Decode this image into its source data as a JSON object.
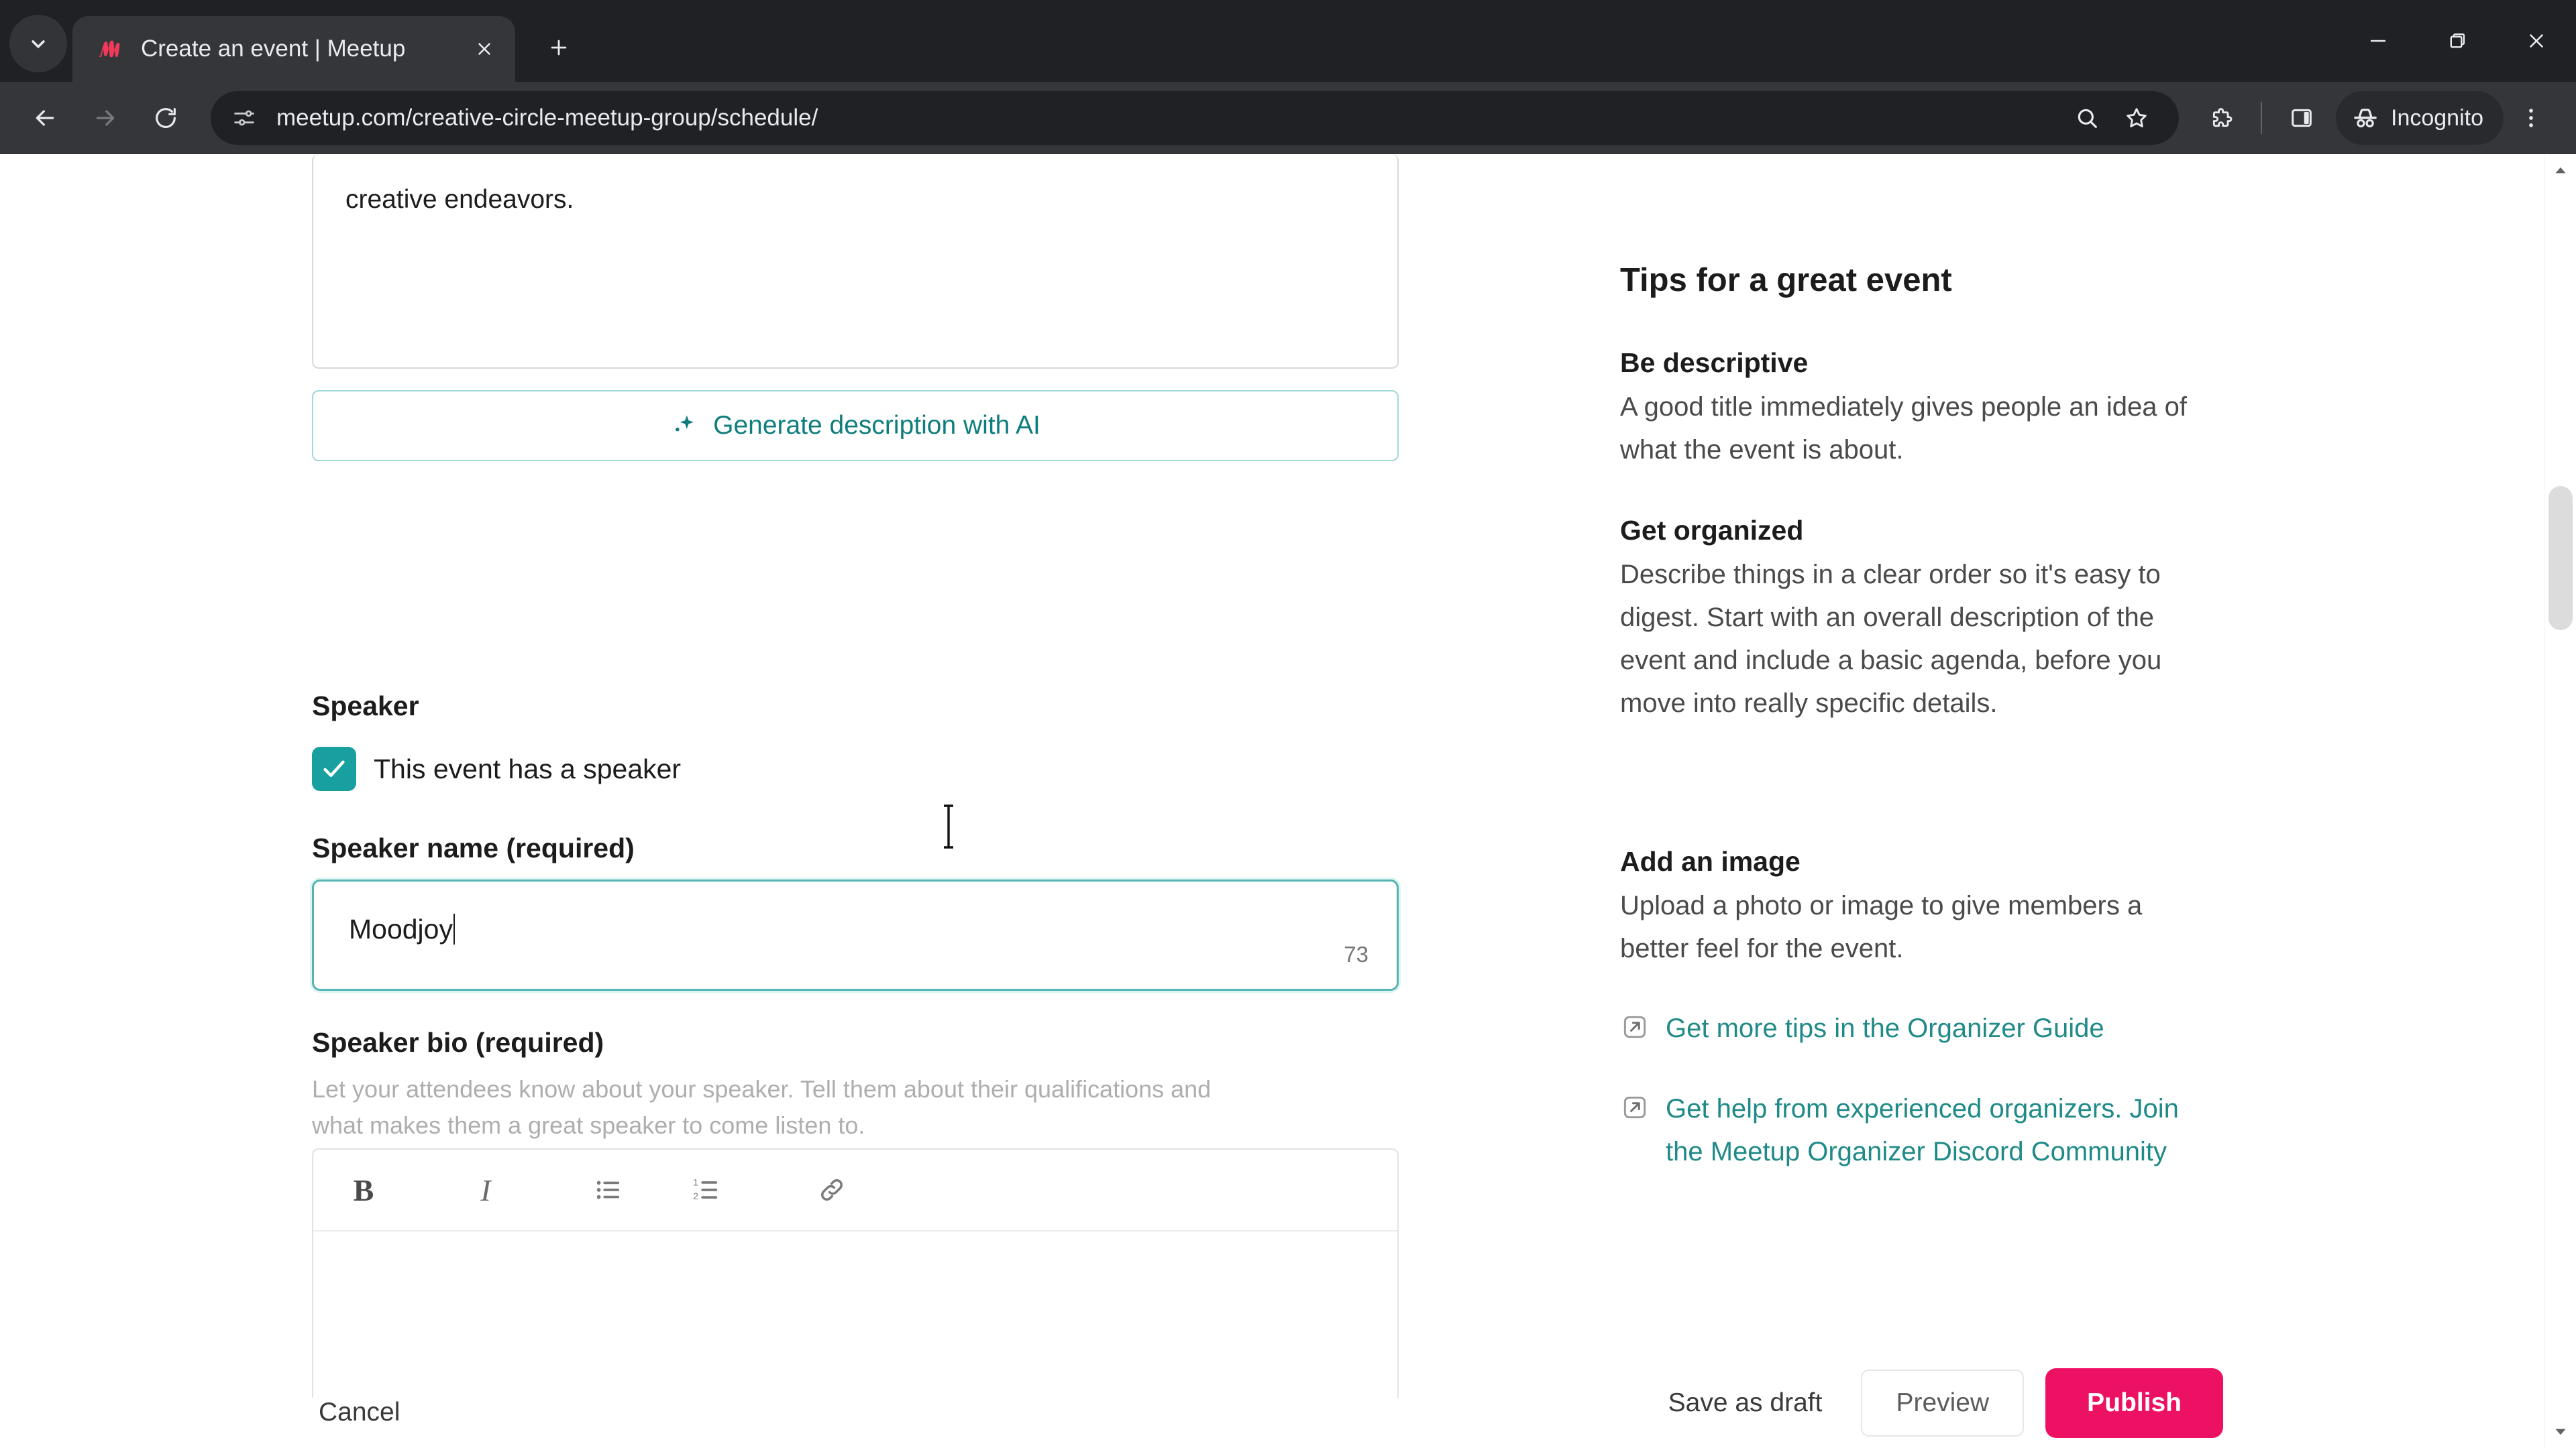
{
  "browser": {
    "tab_search_icon": "chevron-down-icon",
    "tab": {
      "title": "Create an event | Meetup",
      "favicon": "meetup-logo-icon",
      "close_icon": "close-icon"
    },
    "new_tab_icon": "plus-icon",
    "window_controls": {
      "minimize": "minimize-icon",
      "maximize": "restore-icon",
      "close": "close-icon"
    },
    "nav": {
      "back_icon": "arrow-left-icon",
      "forward_icon": "arrow-right-icon",
      "reload_icon": "reload-icon"
    },
    "omnibox": {
      "site_info_icon": "page-settings-icon",
      "url": "meetup.com/creative-circle-meetup-group/schedule/",
      "search_icon": "search-icon",
      "bookmark_icon": "star-icon"
    },
    "toolbar_right": {
      "extensions_icon": "extensions-puzzle-icon",
      "side_panel_icon": "side-panel-icon",
      "incognito_icon": "incognito-hat-icon",
      "incognito_label": "Incognito",
      "menu_icon": "three-dot-menu-icon"
    }
  },
  "form": {
    "description": {
      "text": "creative endeavors."
    },
    "ai_button": {
      "icon": "sparkle-icon",
      "label": "Generate description with AI"
    },
    "speaker_section_heading": "Speaker",
    "speaker_checkbox": {
      "label": "This event has a speaker",
      "checked": true,
      "icon": "checkmark-icon"
    },
    "speaker_name": {
      "label": "Speaker name (required)",
      "value": "Moodjoy",
      "char_count": "73"
    },
    "speaker_bio": {
      "label": "Speaker bio (required)",
      "help_line_1": "Let your attendees know about your speaker. Tell them about their qualifications and",
      "help_line_2": "what makes them a great speaker to come listen to.",
      "value": "",
      "toolbar": [
        {
          "name": "bold",
          "glyph": "B"
        },
        {
          "name": "italic",
          "glyph": "I"
        },
        {
          "name": "bulleted-list",
          "glyph": "bullet-list-icon"
        },
        {
          "name": "numbered-list",
          "glyph": "numbered-list-icon"
        },
        {
          "name": "link",
          "glyph": "link-icon"
        }
      ]
    }
  },
  "tips": {
    "title": "Tips for a great event",
    "items": [
      {
        "heading": "Be descriptive",
        "body": "A good title immediately gives people an idea of what the event is about."
      },
      {
        "heading": "Get organized",
        "body": "Describe things in a clear order so it's easy to digest. Start with an overall description of the event and include a basic agenda, before you move into really specific details."
      },
      {
        "heading": "Add an image",
        "body": "Upload a photo or image to give members a better feel for the event."
      }
    ],
    "links": [
      {
        "icon": "external-link-icon",
        "label": "Get more tips in the Organizer Guide"
      },
      {
        "icon": "external-link-icon",
        "label": "Get help from experienced organizers. Join the Meetup Organizer Discord Community"
      }
    ]
  },
  "actions": {
    "cancel": "Cancel",
    "save_as_draft": "Save as draft",
    "preview": "Preview",
    "publish": "Publish"
  },
  "colors": {
    "brand_pink": "#ed1164",
    "teal_accent": "#18a0a0",
    "link_teal": "#1f8a87",
    "chrome_dark": "#202124"
  }
}
